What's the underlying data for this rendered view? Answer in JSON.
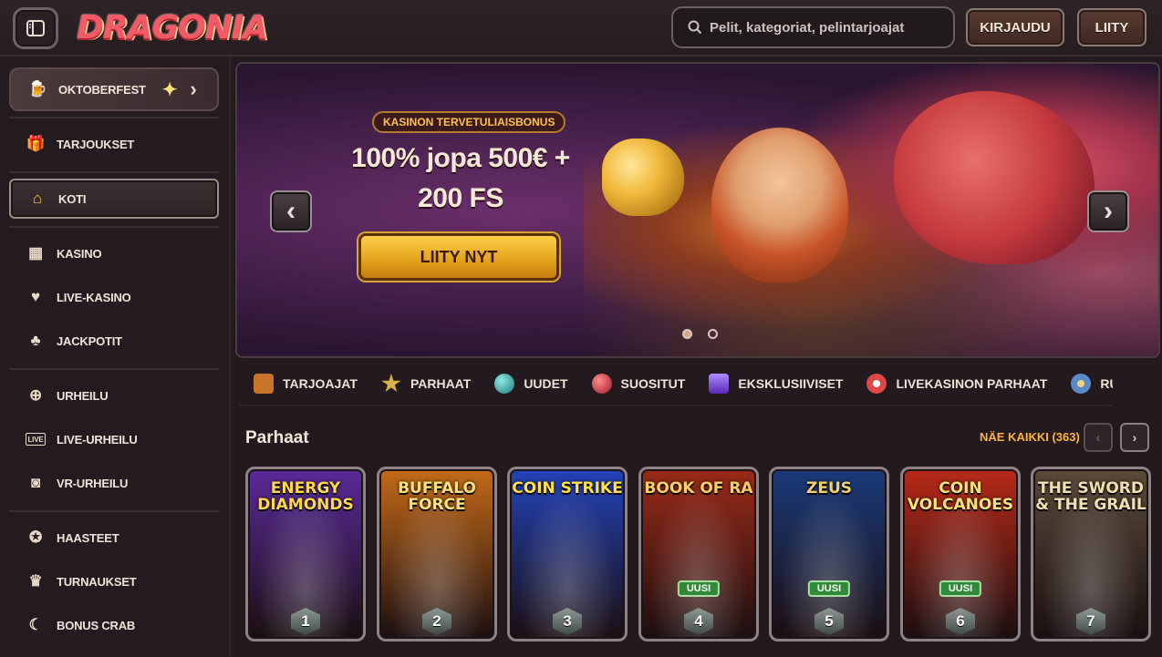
{
  "header": {
    "logo_text": "DRAGONIA",
    "search_placeholder": "Pelit, kategoriat, pelintarjoajat",
    "login_label": "KIRJAUDU",
    "join_label": "LIITY"
  },
  "sidebar": {
    "featured": {
      "label": "OKTOBERFEST",
      "icon": "beer-mug-icon"
    },
    "items": [
      {
        "label": "TARJOUKSET",
        "icon": "gift-icon"
      },
      {
        "label": "KOTI",
        "icon": "home-icon"
      },
      {
        "label": "KASINO",
        "icon": "slot-machine-icon"
      },
      {
        "label": "LIVE-KASINO",
        "icon": "playing-card-icon"
      },
      {
        "label": "JACKPOTIT",
        "icon": "clover-icon"
      },
      {
        "label": "URHEILU",
        "icon": "ball-icon"
      },
      {
        "label": "LIVE-URHEILU",
        "icon": "live-icon"
      },
      {
        "label": "VR-URHEILU",
        "icon": "vr-icon"
      },
      {
        "label": "HAASTEET",
        "icon": "challenge-icon"
      },
      {
        "label": "TURNAUKSET",
        "icon": "trophy-icon"
      },
      {
        "label": "BONUS CRAB",
        "icon": "crab-claw-icon"
      }
    ]
  },
  "banner": {
    "pill": "KASINON TERVETULIAISBONUS",
    "title_line1": "100% jopa 500€ +",
    "title_line2": "200 FS",
    "cta": "LIITY NYT",
    "prev_symbol": "‹",
    "next_symbol": "›",
    "active_slide": 1,
    "slide_count": 2
  },
  "categories": [
    {
      "label": "TARJOAJAT",
      "color": "#c8742a"
    },
    {
      "label": "PARHAAT",
      "color": "#d8b04a"
    },
    {
      "label": "UUDET",
      "color": "#2a9a9a"
    },
    {
      "label": "SUOSITUT",
      "color": "#d23a3a"
    },
    {
      "label": "EKSKLUSIIVISET",
      "color": "#7a4ad8"
    },
    {
      "label": "LIVEKASINON PARHAAT",
      "color": "#e04848"
    },
    {
      "label": "RULETTI",
      "color": "#5a8ac8"
    }
  ],
  "section": {
    "title": "Parhaat",
    "see_all": "NÄE KAIKKI (363)"
  },
  "games": [
    {
      "title": "ENERGY DIAMONDS",
      "rank": "1",
      "badge": "",
      "bg": "#5a2a9a",
      "title_color": "#ffd84a"
    },
    {
      "title": "BUFFALO FORCE",
      "rank": "2",
      "badge": "",
      "bg": "#c46a18",
      "title_color": "#ffe07a"
    },
    {
      "title": "COIN STRIKE",
      "rank": "3",
      "badge": "",
      "bg": "#2242b8",
      "title_color": "#ffe04a"
    },
    {
      "title": "BOOK OF RA",
      "rank": "4",
      "badge": "UUSI",
      "bg": "#9a2a18",
      "title_color": "#ffd060"
    },
    {
      "title": "ZEUS",
      "rank": "5",
      "badge": "UUSI",
      "bg": "#1a3a7a",
      "title_color": "#f2d06a"
    },
    {
      "title": "COIN VOLCANOES",
      "rank": "6",
      "badge": "UUSI",
      "bg": "#b82a18",
      "title_color": "#ffe07a"
    },
    {
      "title": "THE SWORD & THE GRAIL",
      "rank": "7",
      "badge": "",
      "bg": "#5a4a3a",
      "title_color": "#f0e0b0"
    }
  ]
}
